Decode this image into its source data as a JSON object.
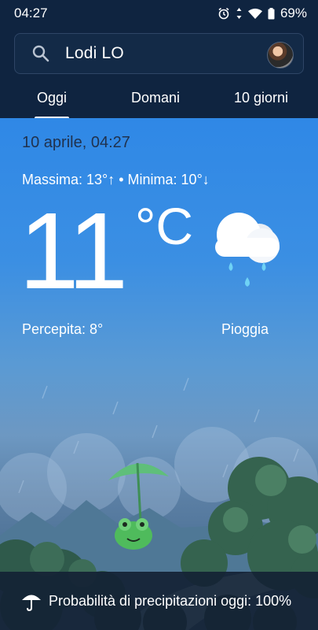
{
  "status_bar": {
    "time": "04:27",
    "battery": "69%"
  },
  "search": {
    "location": "Lodi LO"
  },
  "tabs": [
    {
      "label": "Oggi"
    },
    {
      "label": "Domani"
    },
    {
      "label": "10 giorni"
    }
  ],
  "weather": {
    "date": "10 aprile, 04:27",
    "max_min": "Massima: 13°↑ • Minima: 10°↓",
    "temperature": "11",
    "unit": "°C",
    "feels_like": "Percepita: 8°",
    "condition": "Pioggia"
  },
  "precipitation": {
    "text": "Probabilità di precipitazioni oggi: 100%"
  },
  "icons": {
    "alarm": "alarm-icon",
    "wifi": "wifi-icon",
    "battery": "battery-icon",
    "search": "search-icon",
    "weather": "rain-cloud-icon",
    "umbrella": "umbrella-icon"
  }
}
